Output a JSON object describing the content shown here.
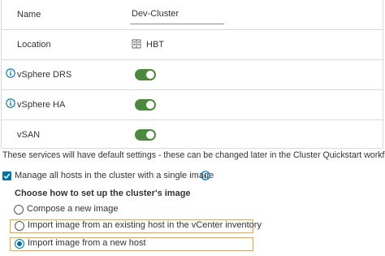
{
  "colors": {
    "toggle_on": "#4b8a3d",
    "checkbox": "#0072a3",
    "highlight_border": "#e8a33d",
    "info_icon": "#0072a3"
  },
  "fields": {
    "name": {
      "label": "Name",
      "value": "Dev-Cluster"
    },
    "location": {
      "label": "Location",
      "value": "HBT",
      "icon": "datacenter-icon"
    },
    "drs": {
      "label": "vSphere DRS",
      "enabled": true,
      "icon": "info-icon"
    },
    "ha": {
      "label": "vSphere HA",
      "enabled": true,
      "icon": "info-icon"
    },
    "vsan": {
      "label": "vSAN",
      "enabled": true
    }
  },
  "note": "These services will have default settings - these can be changed later in the Cluster Quickstart workflow.",
  "manage_image": {
    "label": "Manage all hosts in the cluster with a single image",
    "checked": true,
    "icon": "info-icon"
  },
  "setup": {
    "heading": "Choose how to set up the cluster's image",
    "options": [
      {
        "label": "Compose a new image",
        "selected": false,
        "highlighted": false
      },
      {
        "label": "Import image from an existing host in the vCenter inventory",
        "selected": false,
        "highlighted": true
      },
      {
        "label": "Import image from a new host",
        "selected": true,
        "highlighted": true
      }
    ]
  }
}
